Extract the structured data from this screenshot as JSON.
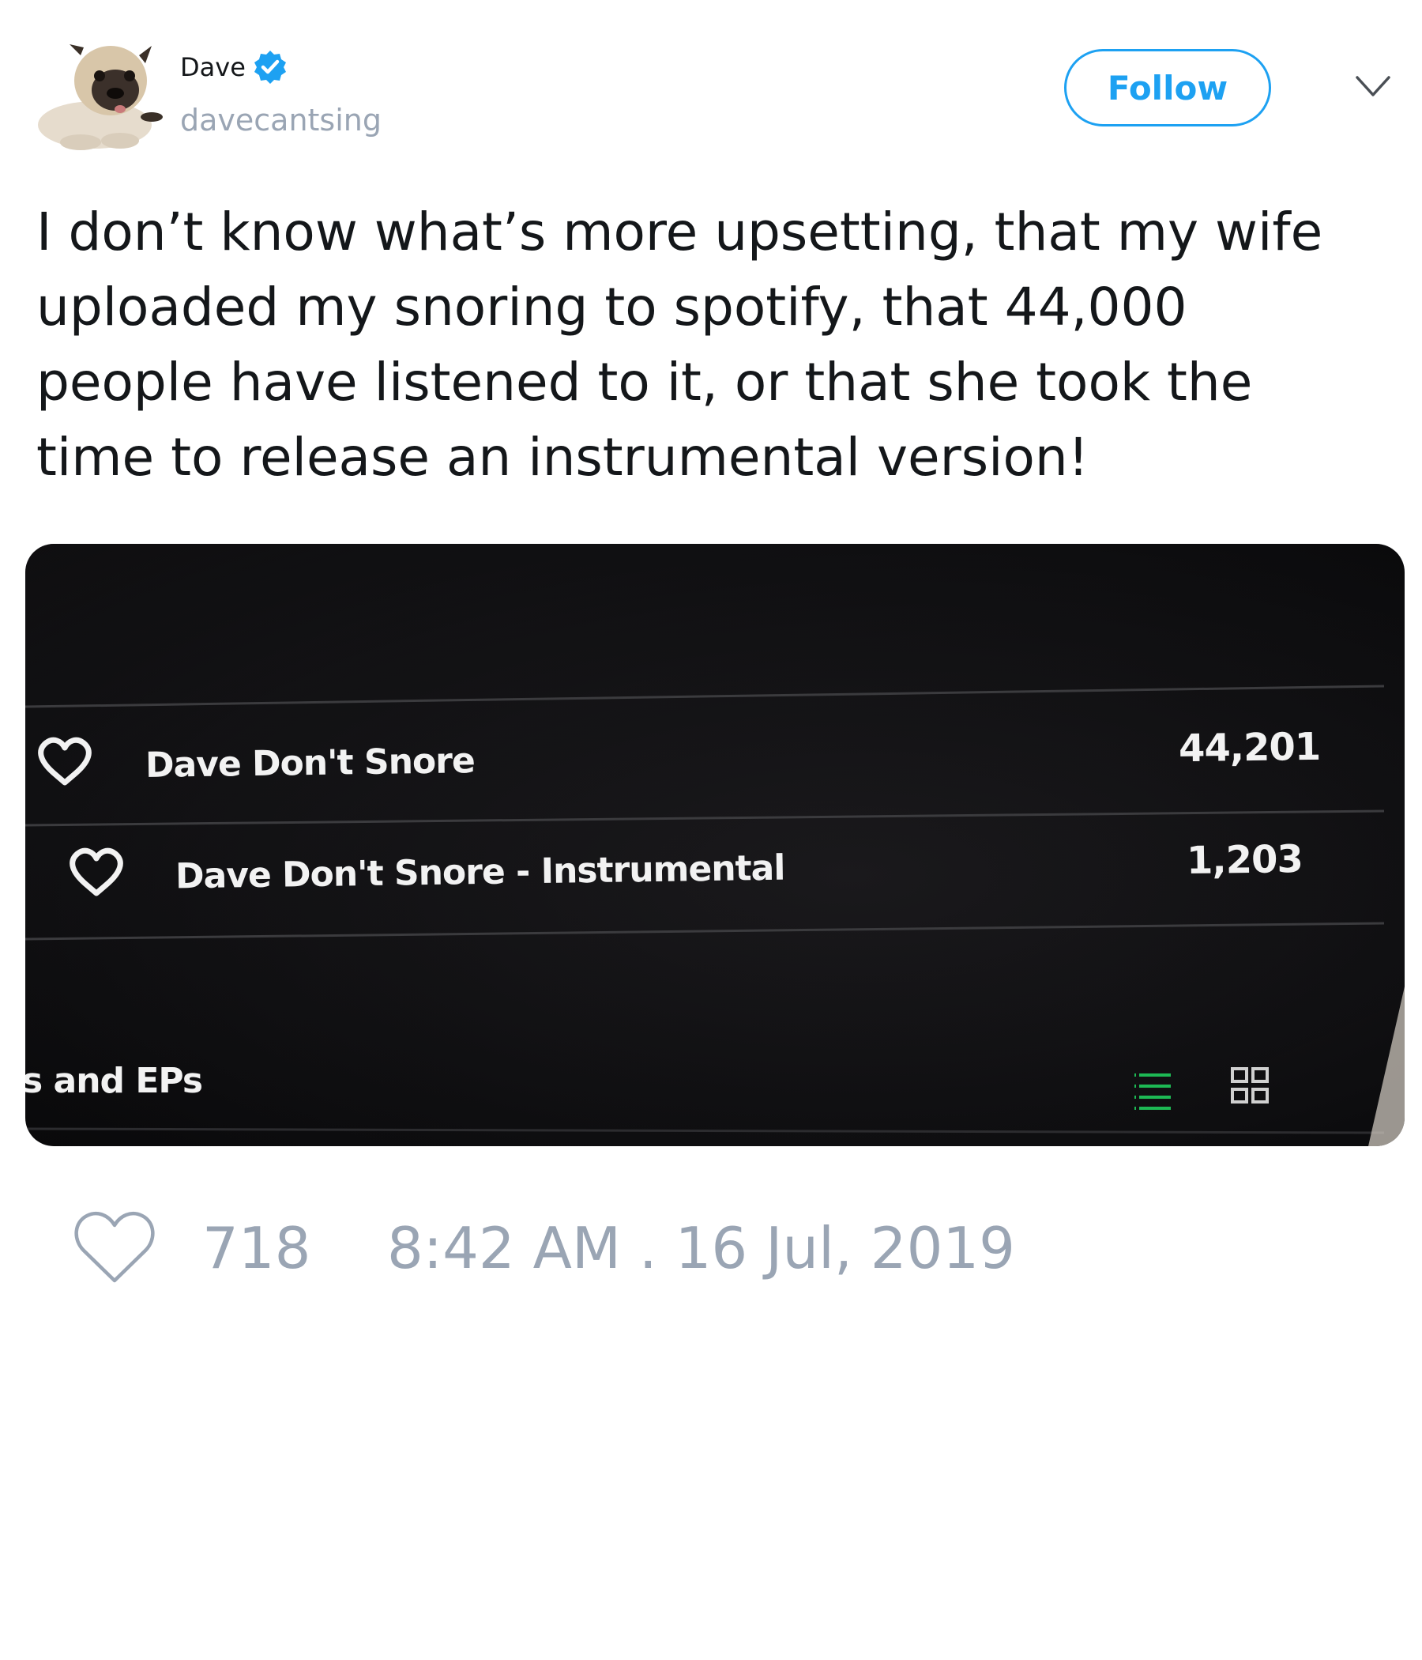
{
  "author": {
    "display_name": "Dave",
    "handle": "davecantsing",
    "verified": true,
    "avatar_icon": "pug-dog-avatar"
  },
  "follow_button": {
    "label": "Follow",
    "color": "#1da1f2"
  },
  "menu_icon": "chevron-down-icon",
  "tweet": {
    "text": "I don’t know what’s more upsetting, that my wife\nuploaded my snoring to spotify, that 44,000\npeople have listened to it, or that she took the\ntime to release an instrumental version!"
  },
  "media": {
    "tracks": [
      {
        "title": "Dave Don't Snore",
        "plays": "44,201"
      },
      {
        "title": "Dave Don't Snore - Instrumental",
        "plays": "1,203"
      }
    ],
    "section_label": "s and EPs",
    "list_view_color": "#1db954"
  },
  "footer": {
    "like_count": "718",
    "timestamp": "8:42 AM . 16 Jul, 2019"
  },
  "colors": {
    "text": "#14171a",
    "muted": "#9aa5b4",
    "accent": "#1da1f2"
  }
}
